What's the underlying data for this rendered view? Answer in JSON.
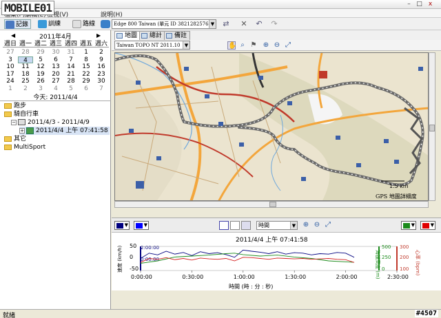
{
  "watermark": {
    "logo": "MOBILE01",
    "id": "#4507"
  },
  "window": {
    "minimize": "–",
    "maximize": "□",
    "close": "x"
  },
  "menu": [
    {
      "label": "檔案(F)"
    },
    {
      "label": "編輯(E)"
    },
    {
      "label": "檢視(V)"
    },
    {
      "label": "說明(H)"
    }
  ],
  "toolbar": {
    "records_label": "記錄",
    "training_label": "訓練",
    "routes_label": "路線",
    "device_value": "Edge 800 Taiwan (單元 ID 3821282576)"
  },
  "calendar": {
    "month": "2011年4月",
    "prev": "◀",
    "next": "▶",
    "weekdays": [
      "週日",
      "週一",
      "週二",
      "週三",
      "週四",
      "週五",
      "週六"
    ],
    "weeks": [
      [
        "27",
        "28",
        "29",
        "30",
        "31",
        "1",
        "2"
      ],
      [
        "3",
        "4",
        "5",
        "6",
        "7",
        "8",
        "9"
      ],
      [
        "10",
        "11",
        "12",
        "13",
        "14",
        "15",
        "16"
      ],
      [
        "17",
        "18",
        "19",
        "20",
        "21",
        "22",
        "23"
      ],
      [
        "24",
        "25",
        "26",
        "27",
        "28",
        "29",
        "30"
      ],
      [
        "1",
        "2",
        "3",
        "4",
        "5",
        "6",
        "7"
      ]
    ],
    "today": "今天: 2011/4/4"
  },
  "tree": {
    "items": [
      {
        "label": "跑步"
      },
      {
        "label": "騎自行車"
      },
      {
        "label": "2011/4/3 - 2011/4/9"
      },
      {
        "label": "2011/4/4 上午 07:41:58"
      },
      {
        "label": "其它"
      },
      {
        "label": "MultiSport"
      }
    ]
  },
  "tabs": [
    {
      "label": "地圖"
    },
    {
      "label": "總計"
    },
    {
      "label": "備註"
    }
  ],
  "map": {
    "mapset": "Taiwan TOPO NT 2011.10",
    "scale": "1.5 km",
    "detail": "GPS 地圖詳細度"
  },
  "chart_toolbar": {
    "x_axis_option": "時間"
  },
  "colors": {
    "speed": "#00007f",
    "elevation": "#2bb52b",
    "heart_rate": "#d42020",
    "track": "#6a6a6a"
  },
  "chart_data": {
    "type": "line",
    "title": "2011/4/4 上午 07:41:58",
    "xlabel": "時間 (時 : 分 : 秒)",
    "x_ticks": [
      "0:00:00",
      "0:30:00",
      "1:00:00",
      "1:30:00",
      "2:00:00",
      "2:30:00"
    ],
    "xlim": [
      0,
      150
    ],
    "axes": {
      "left": {
        "label": "速度 (km/h)",
        "ticks": [
          "50",
          "0",
          "-50"
        ],
        "range": [
          -50,
          50
        ]
      },
      "right1": {
        "label": "海拔高度 (m)",
        "ticks": [
          "500",
          "250",
          "0"
        ],
        "range": [
          0,
          500
        ]
      },
      "right2": {
        "label": "心率 (bpm)",
        "ticks": [
          "300",
          "200",
          "100"
        ],
        "range": [
          0,
          300
        ]
      }
    },
    "pace_ticks": [
      "2:00:00",
      "0:00:00"
    ],
    "series": [
      {
        "name": "速度",
        "axis": "left",
        "x": [
          0,
          5,
          10,
          15,
          20,
          25,
          30,
          35,
          40,
          45,
          50,
          55,
          60,
          65,
          70,
          75,
          80,
          85,
          90,
          95,
          100,
          105,
          110,
          115,
          120,
          125
        ],
        "values": [
          0,
          22,
          15,
          30,
          18,
          25,
          12,
          28,
          20,
          24,
          16,
          5,
          35,
          30,
          26,
          20,
          28,
          18,
          24,
          22,
          15,
          20,
          18,
          25,
          22,
          5
        ]
      },
      {
        "name": "海拔高度",
        "axis": "right1",
        "x": [
          0,
          10,
          20,
          30,
          40,
          50,
          55,
          60,
          70,
          80,
          90,
          100,
          110,
          120,
          125
        ],
        "values": [
          150,
          200,
          280,
          300,
          320,
          350,
          360,
          330,
          300,
          320,
          280,
          250,
          200,
          180,
          170
        ]
      },
      {
        "name": "心率",
        "axis": "right2",
        "x": [
          0,
          5,
          10,
          15,
          20,
          25,
          30,
          35,
          40,
          45,
          50,
          55,
          60,
          65,
          70,
          75,
          80,
          85,
          90,
          95,
          100,
          105,
          110,
          115,
          120,
          125
        ],
        "values": [
          100,
          150,
          140,
          160,
          135,
          150,
          130,
          155,
          145,
          140,
          150,
          120,
          165,
          160,
          150,
          140,
          155,
          150,
          145,
          150,
          140,
          145,
          150,
          140,
          135,
          100
        ]
      }
    ]
  },
  "status": {
    "text": "就緒"
  }
}
